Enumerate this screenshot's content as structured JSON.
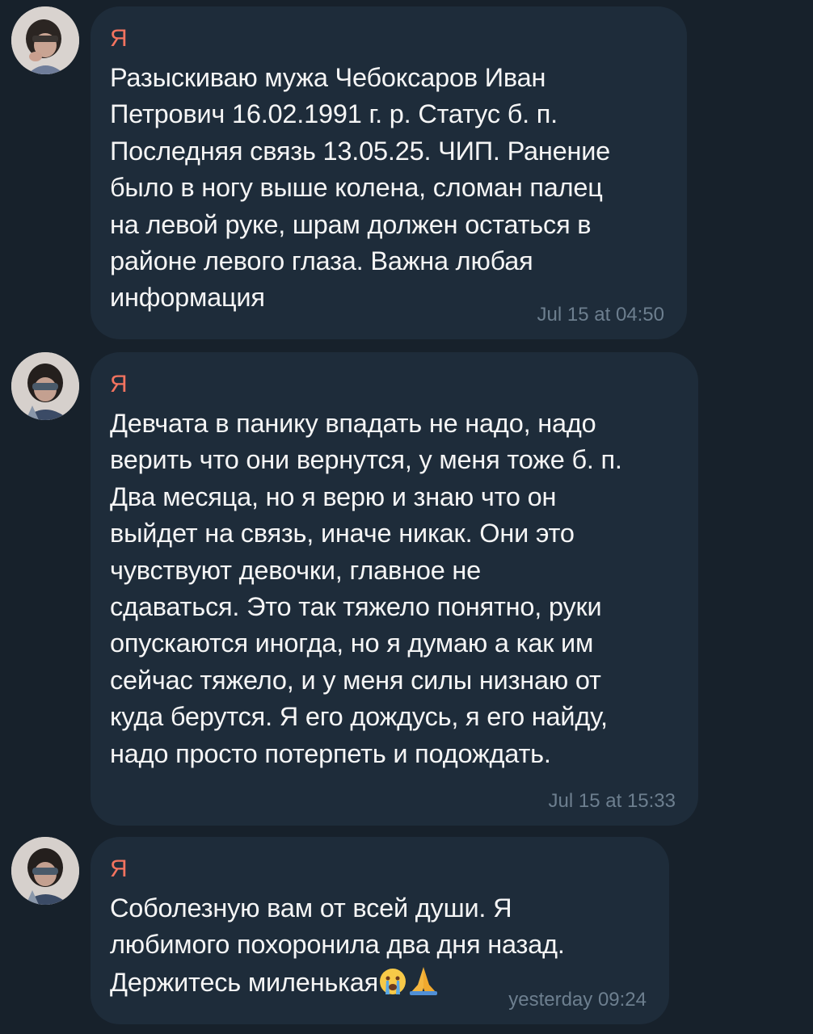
{
  "messages": [
    {
      "sender": "Я",
      "text": "Разыскиваю мужа Чебоксаров Иван\nПетрович 16.02.1991 г. р. Статус б. п.\nПоследняя связь 13.05.25. ЧИП. Ранение\nбыло в ногу выше колена, сломан палец\nна левой руке, шрам должен остаться в\nрайоне левого глаза. Важна любая\nинформация",
      "time": "Jul 15 at 04:50"
    },
    {
      "sender": "Я",
      "text": "Девчата в панику впадать не надо, надо\nверить что они вернутся, у меня тоже б. п.\nДва месяца, но я верю и знаю что он\nвыйдет на связь, иначе никак. Они это\nчувствуют девочки, главное не\nсдаваться. Это так тяжело понятно, руки\nопускаются иногда, но я думаю а как им\nсейчас тяжело, и у меня силы низнаю от\nкуда берутся. Я его дождусь, я его найду,\nнадо просто потерпеть и подождать.",
      "time": "Jul 15 at 15:33"
    },
    {
      "sender": "Я",
      "text": "Соболезную вам от всей души. Я\nлюбимого похоронила два дня назад.\nДержитесь миленькая",
      "emojis": [
        "crying-face",
        "folded-hands"
      ],
      "time": "yesterday 09:24"
    }
  ],
  "colors": {
    "background": "#17212b",
    "bubble": "#1e2c3a",
    "sender": "#f3735f",
    "text": "#f5f5f5",
    "time": "#6d7f8f"
  }
}
